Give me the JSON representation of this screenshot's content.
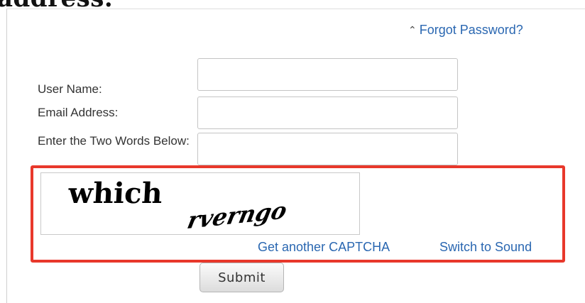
{
  "page": {
    "heading_fragment": "address."
  },
  "form": {
    "forgot_link": "Forgot Password?",
    "username_label": "User Name:",
    "username_value": "",
    "email_label": "Email Address:",
    "email_value": "",
    "captcha_label": "Enter the Two Words Below:",
    "captcha_value": "",
    "captcha_words": [
      "which",
      "rverngo"
    ],
    "another_captcha_link": "Get another CAPTCHA",
    "switch_sound_link": "Switch to Sound",
    "submit_label": "Submit"
  },
  "colors": {
    "link": "#2a67b1",
    "highlight": "#e8382b"
  },
  "icons": {
    "forgot_toggle": "double-chevron-up-icon"
  }
}
